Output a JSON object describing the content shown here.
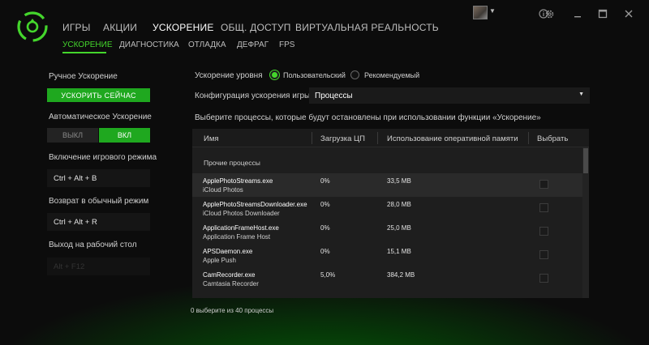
{
  "nav": {
    "main_tabs": [
      "ИГРЫ",
      "АКЦИИ",
      "УСКОРЕНИЕ",
      "ОБЩ. ДОСТУП",
      "ВИРТУАЛЬНАЯ РЕАЛЬНОСТЬ"
    ],
    "sub_tabs": [
      "УСКОРЕНИЕ",
      "ДИАГНОСТИКА",
      "ОТЛАДКА",
      "ДЕФРАГ",
      "FPS"
    ],
    "active_main_tab": "УСКОРЕНИЕ",
    "active_sub_tab": "УСКОРЕНИЕ"
  },
  "window_controls": {
    "icons": [
      "user-avatar",
      "info-icon",
      "gear-icon",
      "minimize-icon",
      "maximize-icon",
      "close-icon"
    ]
  },
  "left": {
    "manual_title": "Ручное Ускорение",
    "boost_now": "УСКОРИТЬ СЕЙЧАС",
    "auto_title": "Автоматическое Ускорение",
    "toggle_off": "ВЫКЛ",
    "toggle_on": "ВКЛ",
    "game_mode_title": "Включение игрового режима",
    "game_mode_hotkey": "Ctrl + Alt + B",
    "normal_mode_title": "Возврат в обычный режим",
    "normal_mode_hotkey": "Ctrl + Alt + R",
    "desktop_title": "Выход на рабочий стол",
    "desktop_hotkey": "Alt + F12"
  },
  "right": {
    "level_label": "Ускорение уровня",
    "option_custom": "Пользовательский",
    "option_recommended": "Рекомендуемый",
    "config_label": "Конфигурация ускорения игры",
    "config_value": "Процессы",
    "description": "Выберите процессы, которые будут остановлены при использовании функции «Ускорение»",
    "selection_count": "0 выберите из 40 процессы"
  },
  "table": {
    "headers": [
      "Имя",
      "Загрузка ЦП",
      "Использование оперативной памяти",
      "Выбрать"
    ],
    "group_label": "Прочие процессы",
    "rows": [
      {
        "name": "ApplePhotoStreams.exe",
        "desc": "iCloud Photos",
        "cpu": "0%",
        "ram": "33,5 MB",
        "selected": false
      },
      {
        "name": "ApplePhotoStreamsDownloader.exe",
        "desc": "iCloud Photos Downloader",
        "cpu": "0%",
        "ram": "28,0 MB",
        "selected": false
      },
      {
        "name": "ApplicationFrameHost.exe",
        "desc": "Application Frame Host",
        "cpu": "0%",
        "ram": "25,0 MB",
        "selected": false
      },
      {
        "name": "APSDaemon.exe",
        "desc": "Apple Push",
        "cpu": "0%",
        "ram": "15,1 MB",
        "selected": false
      },
      {
        "name": "CamRecorder.exe",
        "desc": "Camtasia Recorder",
        "cpu": "5,0%",
        "ram": "384,2 MB",
        "selected": false
      }
    ]
  },
  "colors": {
    "accent": "#44d62c",
    "button_green": "#1fa81f",
    "background": "#0d0d0d"
  }
}
